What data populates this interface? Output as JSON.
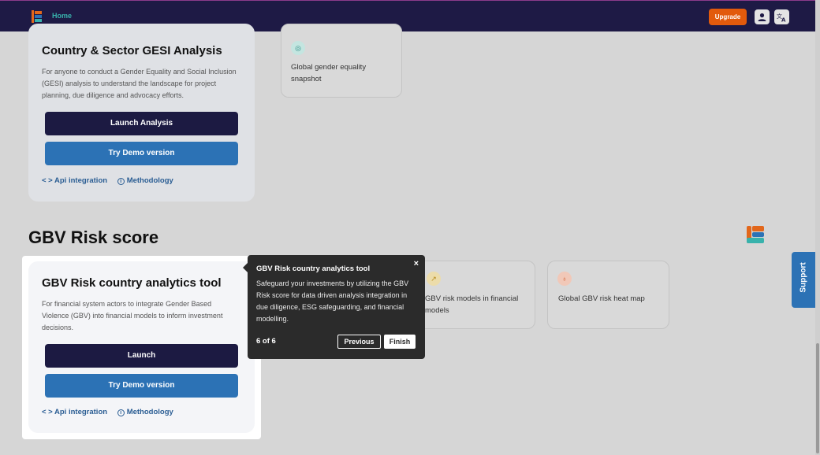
{
  "topbar": {
    "home_label": "Home",
    "upgrade_label": "Upgrade",
    "user_icon": "user-icon",
    "language_icon": "translate-icon"
  },
  "gesi_card": {
    "title": "Country & Sector GESI Analysis",
    "description": "For anyone to conduct a Gender Equality and Social Inclusion (GESI) analysis to understand the landscape for project planning, due diligence and advocacy efforts.",
    "primary_button": "Launch Analysis",
    "demo_button": "Try Demo version",
    "api_link": "< > Api integration",
    "methodology_link": "Methodology"
  },
  "gesi_related": {
    "label": "Global gender equality snapshot",
    "icon": "globe-icon"
  },
  "gbv_section": {
    "title": "GBV Risk score"
  },
  "gbv_card": {
    "title": "GBV Risk country analytics tool",
    "description": "For financial system actors to integrate Gender Based Violence (GBV) into financial models to inform investment decisions.",
    "primary_button": "Launch",
    "demo_button": "Try Demo version",
    "api_link": "< > Api integration",
    "methodology_link": "Methodology"
  },
  "gbv_related": [
    {
      "label": "GBV risk models in financial models",
      "icon": "chart-icon"
    },
    {
      "label": "Global GBV risk heat map",
      "icon": "heatmap-icon"
    }
  ],
  "support_label": "Support",
  "tour": {
    "title": "GBV Risk country analytics tool",
    "description": "Safeguard your investments by utilizing the GBV Risk score for data driven analysis integration in due diligence, ESG safeguarding, and financial modelling.",
    "progress": "6 of 6",
    "previous_label": "Previous",
    "finish_label": "Finish",
    "close_glyph": "×"
  },
  "colors": {
    "navbar": "#1e1a45",
    "upgrade": "#e25a0c",
    "primary_dark": "#1c1a42",
    "primary_blue": "#2c72b5",
    "link": "#2a5d93",
    "tooltip": "#2b2b2b"
  }
}
